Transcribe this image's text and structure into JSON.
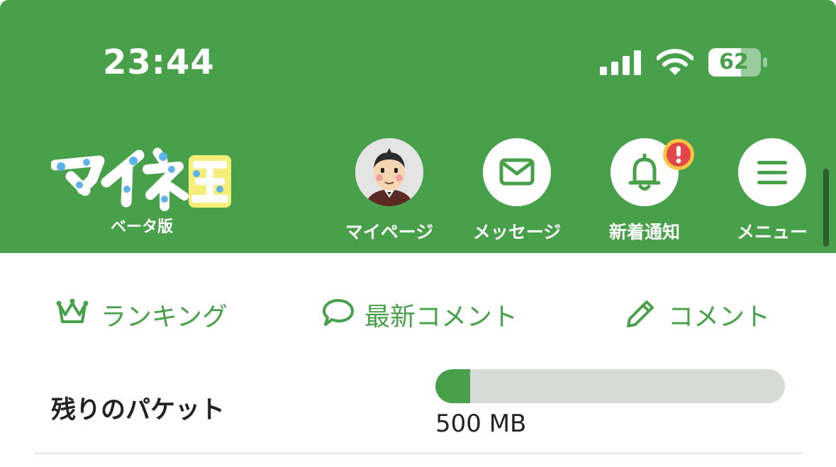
{
  "status_bar": {
    "time": "23:44",
    "battery_percent": "62",
    "icons": [
      "cellular-signal-icon",
      "wifi-icon",
      "battery-icon"
    ]
  },
  "header": {
    "logo_text": "マイネ王",
    "logo_subtitle": "ベータ版",
    "nav": [
      {
        "label": "マイページ",
        "icon": "avatar"
      },
      {
        "label": "メッセージ",
        "icon": "envelope-icon"
      },
      {
        "label": "新着通知",
        "icon": "bell-icon",
        "badge": "!"
      },
      {
        "label": "メニュー",
        "icon": "hamburger-icon"
      }
    ]
  },
  "subnav": [
    {
      "label": "ランキング",
      "icon": "crown-icon"
    },
    {
      "label": "最新コメント",
      "icon": "speech-bubble-icon"
    },
    {
      "label": "コメント",
      "icon": "pencil-icon"
    }
  ],
  "packet": {
    "label": "残りのパケット",
    "value_text": "500 MB",
    "fill_fraction": 0.1
  },
  "colors": {
    "brand_green": "#48a04b",
    "track_gray": "#d6dbd8",
    "badge_red": "#e4474a",
    "badge_ring": "#f5c543"
  }
}
